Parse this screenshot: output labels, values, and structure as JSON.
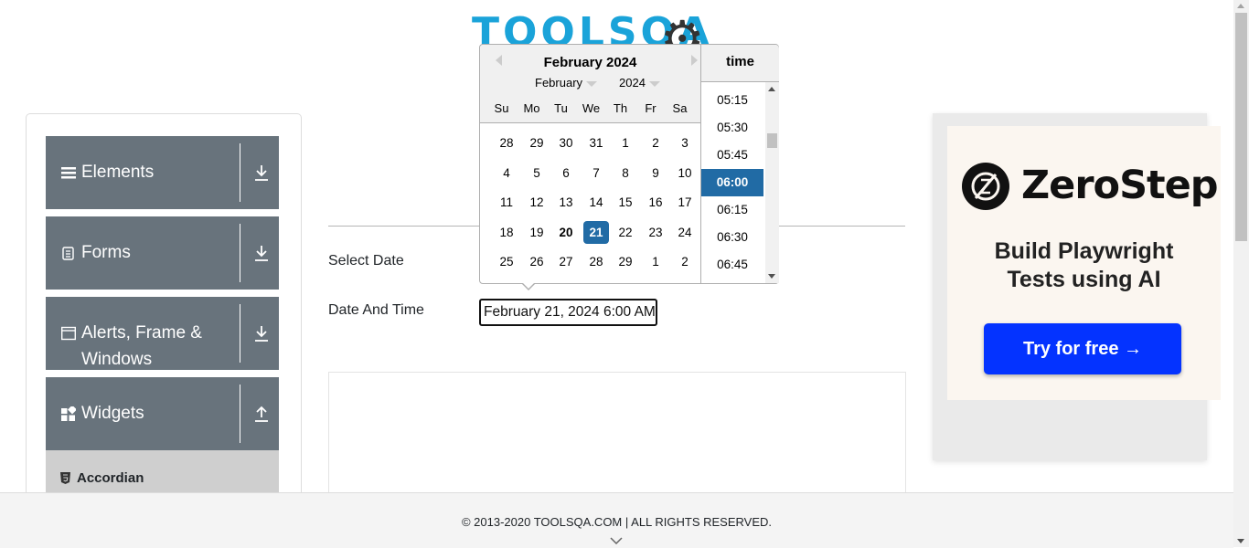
{
  "header": {
    "logo_text": "TOOLSQA"
  },
  "sidebar": {
    "groups": [
      {
        "label": "Elements",
        "icon": "hamburger-icon",
        "state": "collapsed"
      },
      {
        "label": "Forms",
        "icon": "document-icon",
        "state": "collapsed"
      },
      {
        "label": "Alerts, Frame & Windows",
        "icon": "window-icon",
        "state": "collapsed"
      },
      {
        "label": "Widgets",
        "icon": "widgets-icon",
        "state": "expanded"
      }
    ],
    "items": [
      {
        "label": "Accordian",
        "icon": "html5-icon"
      }
    ]
  },
  "form": {
    "select_date_label": "Select Date",
    "date_time_label": "Date And Time",
    "date_time_value": "February 21, 2024 6:00 AM"
  },
  "datepicker": {
    "current_month": "February 2024",
    "month_select": "February",
    "year_select": "2024",
    "day_names": [
      "Su",
      "Mo",
      "Tu",
      "We",
      "Th",
      "Fr",
      "Sa"
    ],
    "weeks": [
      [
        "28",
        "29",
        "30",
        "31",
        "1",
        "2",
        "3"
      ],
      [
        "4",
        "5",
        "6",
        "7",
        "8",
        "9",
        "10"
      ],
      [
        "11",
        "12",
        "13",
        "14",
        "15",
        "16",
        "17"
      ],
      [
        "18",
        "19",
        "20",
        "21",
        "22",
        "23",
        "24"
      ],
      [
        "25",
        "26",
        "27",
        "28",
        "29",
        "1",
        "2"
      ]
    ],
    "today": "20",
    "selected_day": "21",
    "time_header": "time",
    "times": [
      "05:15",
      "05:30",
      "05:45",
      "06:00",
      "06:15",
      "06:30",
      "06:45"
    ],
    "selected_time": "06:00"
  },
  "ad": {
    "brand": "ZeroStep",
    "tagline_line1": "Build Playwright",
    "tagline_line2": "Tests using AI",
    "button_label": "Try for free →"
  },
  "footer": {
    "copyright": "© 2013-2020 TOOLSQA.COM | ALL RIGHTS RESERVED."
  },
  "colors": {
    "accent": "#216ba5",
    "sidebar": "#68737c",
    "ad_button": "#0433ff",
    "logo": "#1aa3d9"
  }
}
